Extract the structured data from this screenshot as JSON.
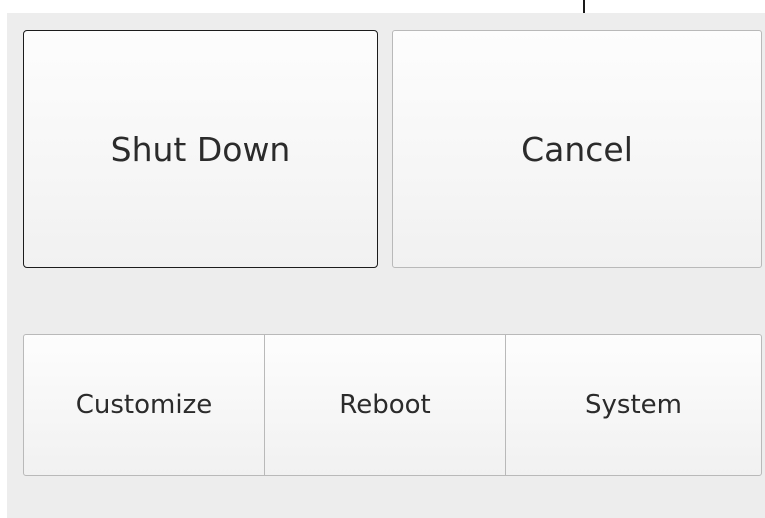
{
  "dialog": {
    "primary_actions": {
      "shutdown_label": "Shut Down",
      "cancel_label": "Cancel"
    },
    "secondary_actions": {
      "customize_label": "Customize",
      "reboot_label": "Reboot",
      "system_label": "System"
    }
  },
  "colors": {
    "background": "#ededed",
    "button_face": "#f6f6f6",
    "focus_border": "#1c1c1c",
    "text": "#2b2b2b"
  }
}
